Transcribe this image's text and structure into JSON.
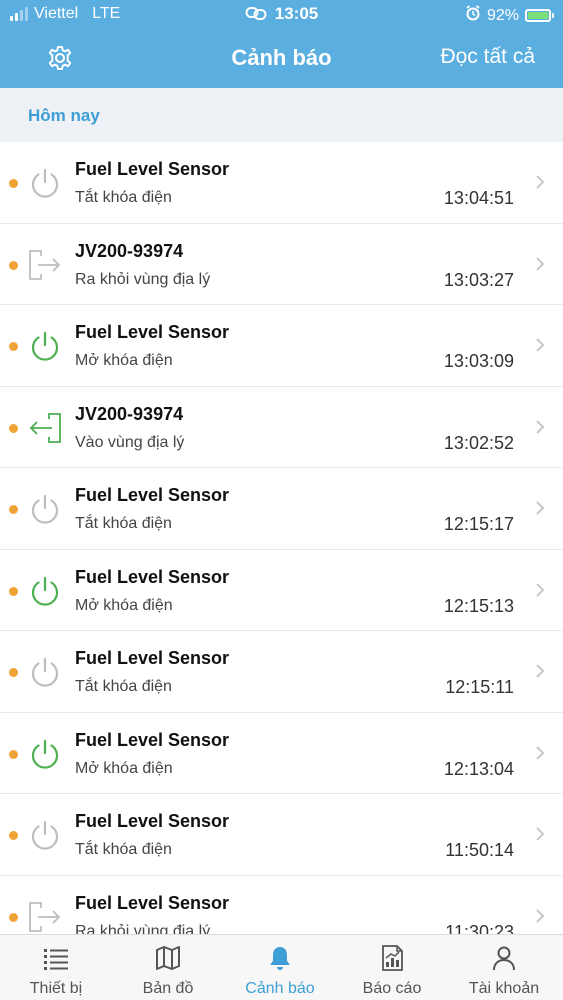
{
  "status_bar": {
    "carrier": "Viettel",
    "network": "LTE",
    "time": "13:05",
    "battery_percent": "92%",
    "battery_level": 0.92,
    "signal_bars_on": 2,
    "icons": [
      "signal-icon",
      "link-icon",
      "alarm-icon",
      "battery-charging-icon"
    ]
  },
  "nav": {
    "title": "Cảnh báo",
    "action": "Đọc tất cả",
    "left_icon": "gear-icon"
  },
  "section": {
    "label": "Hôm nay"
  },
  "alerts": [
    {
      "title": "Fuel Level Sensor",
      "subtitle": "Tắt khóa điện",
      "time": "13:04:51",
      "icon": "power-off-icon"
    },
    {
      "title": "JV200-93974",
      "subtitle": "Ra khỏi vùng địa lý",
      "time": "13:03:27",
      "icon": "exit-zone-icon"
    },
    {
      "title": "Fuel Level Sensor",
      "subtitle": "Mở khóa điện",
      "time": "13:03:09",
      "icon": "power-on-icon"
    },
    {
      "title": "JV200-93974",
      "subtitle": "Vào vùng địa lý",
      "time": "13:02:52",
      "icon": "enter-zone-icon"
    },
    {
      "title": "Fuel Level Sensor",
      "subtitle": "Tắt khóa điện",
      "time": "12:15:17",
      "icon": "power-off-icon"
    },
    {
      "title": "Fuel Level Sensor",
      "subtitle": "Mở khóa điện",
      "time": "12:15:13",
      "icon": "power-on-icon"
    },
    {
      "title": "Fuel Level Sensor",
      "subtitle": "Tắt khóa điện",
      "time": "12:15:11",
      "icon": "power-off-icon"
    },
    {
      "title": "Fuel Level Sensor",
      "subtitle": "Mở khóa điện",
      "time": "12:13:04",
      "icon": "power-on-icon"
    },
    {
      "title": "Fuel Level Sensor",
      "subtitle": "Tắt khóa điện",
      "time": "11:50:14",
      "icon": "power-off-icon"
    },
    {
      "title": "Fuel Level Sensor",
      "subtitle": "Ra khỏi vùng địa lý",
      "time": "11:30:23",
      "icon": "exit-zone-icon"
    }
  ],
  "tabs": [
    {
      "label": "Thiết bị",
      "icon": "list-icon",
      "active": false
    },
    {
      "label": "Bản đồ",
      "icon": "map-icon",
      "active": false
    },
    {
      "label": "Cảnh báo",
      "icon": "bell-icon",
      "active": true
    },
    {
      "label": "Báo cáo",
      "icon": "report-icon",
      "active": false
    },
    {
      "label": "Tài khoản",
      "icon": "account-icon",
      "active": false
    }
  ],
  "colors": {
    "header": "#5aaee0",
    "accent": "#3d9fd6",
    "unread_dot": "#f0a334",
    "power_on_green": "#4caf50",
    "inactive_gray": "#bdbdbd",
    "section_bg": "#eef1f5"
  }
}
